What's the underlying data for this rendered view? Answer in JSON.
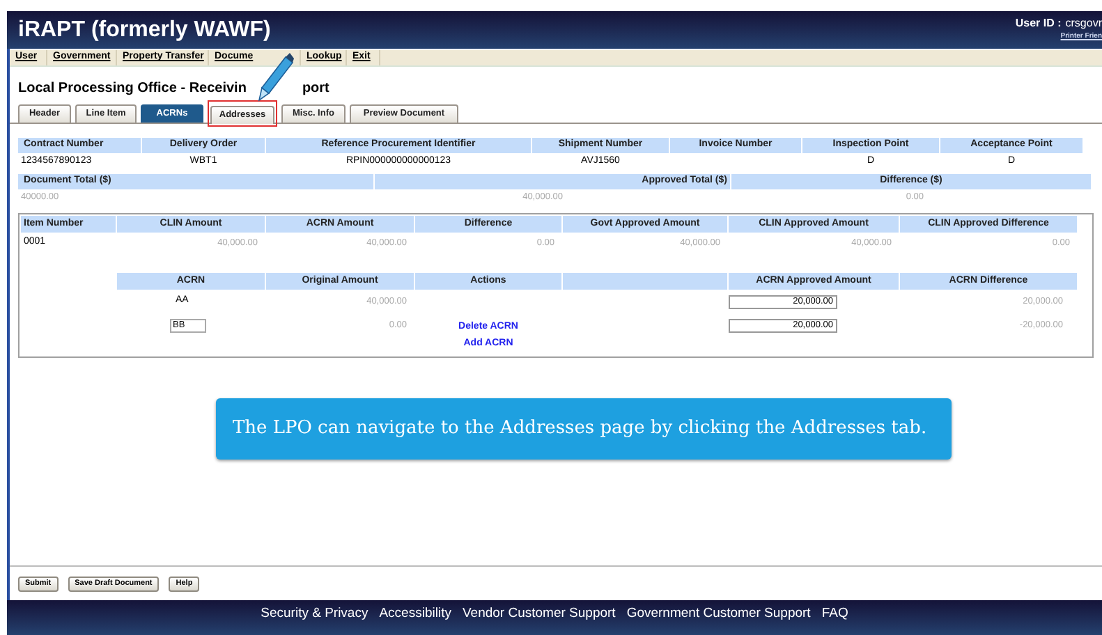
{
  "header": {
    "app_title": "iRAPT (formerly WAWF)",
    "user_id_label": "User ID :",
    "user_id": "crsgovr",
    "printer_link": "Printer Frien"
  },
  "menu": [
    "User",
    "Government",
    "Property Transfer",
    "Docume",
    "Lookup",
    "Exit"
  ],
  "page_title_parts": [
    "Local Processing Office - Receivin",
    "port"
  ],
  "tabs": [
    {
      "label": "Header",
      "selected": false,
      "highlighted": false
    },
    {
      "label": "Line Item",
      "selected": false,
      "highlighted": false
    },
    {
      "label": "ACRNs",
      "selected": true,
      "highlighted": false
    },
    {
      "label": "Addresses",
      "selected": false,
      "highlighted": true
    },
    {
      "label": "Misc. Info",
      "selected": false,
      "highlighted": false
    },
    {
      "label": "Preview Document",
      "selected": false,
      "highlighted": false
    }
  ],
  "summary": [
    {
      "header": "Contract Number",
      "value": "1234567890123"
    },
    {
      "header": "Delivery Order",
      "value": "WBT1"
    },
    {
      "header": "Reference Procurement Identifier",
      "value": "RPIN000000000000123"
    },
    {
      "header": "Shipment Number",
      "value": "AVJ1560"
    },
    {
      "header": "Invoice Number"
    },
    {
      "header": "Inspection Point",
      "value": "D"
    },
    {
      "header": "Acceptance Point",
      "value": "D"
    }
  ],
  "totals": {
    "columns": [
      "Document Total ($)",
      "Approved Total ($)",
      "Difference ($)"
    ],
    "values": [
      "40000.00",
      "40,000.00",
      "0.00"
    ]
  },
  "line_items": {
    "columns": [
      "Item Number",
      "CLIN Amount",
      "ACRN Amount",
      "Difference",
      "Govt Approved Amount",
      "CLIN Approved Amount",
      "CLIN Approved Difference"
    ],
    "rows": [
      [
        "0001",
        "40,000.00",
        "40,000.00",
        "0.00",
        "40,000.00",
        "40,000.00",
        "0.00"
      ]
    ]
  },
  "acrns": {
    "columns": [
      "ACRN",
      "Original Amount",
      "Actions",
      "",
      "ACRN Approved Amount",
      "ACRN Difference"
    ],
    "rows": [
      {
        "acrn": "AA",
        "acrn_editable": false,
        "original": "40,000.00",
        "action": "",
        "approved": "20,000.00",
        "difference": "20,000.00"
      },
      {
        "acrn": "BB",
        "acrn_editable": true,
        "original": "0.00",
        "action": "Delete ACRN",
        "approved": "20,000.00",
        "difference": "-20,000.00"
      }
    ],
    "add_link": "Add ACRN"
  },
  "callout": "The LPO can navigate to the Addresses page by clicking the Addresses tab.",
  "buttons": [
    "Submit",
    "Save Draft Document",
    "Help"
  ],
  "footer_links": [
    "Security & Privacy",
    "Accessibility",
    "Vendor Customer Support",
    "Government Customer Support",
    "FAQ"
  ]
}
